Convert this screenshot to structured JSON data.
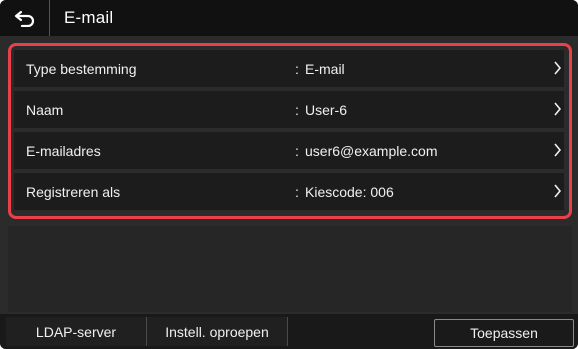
{
  "header": {
    "title": "E-mail",
    "back_icon": "back-arrow-icon"
  },
  "rows": [
    {
      "label": "Type bestemming",
      "separator": ":",
      "value": "E-mail"
    },
    {
      "label": "Naam",
      "separator": ":",
      "value": "User-6"
    },
    {
      "label": "E-mailadres",
      "separator": ":",
      "value": "user6@example.com"
    },
    {
      "label": "Registreren als",
      "separator": ":",
      "value": "Kiescode: 006"
    }
  ],
  "footer": {
    "ldap_label": "LDAP-server",
    "recall_label": "Instell. oproepen",
    "apply_label": "Toepassen"
  },
  "colors": {
    "highlight": "#e8414c",
    "background": "#2b2b2b"
  }
}
